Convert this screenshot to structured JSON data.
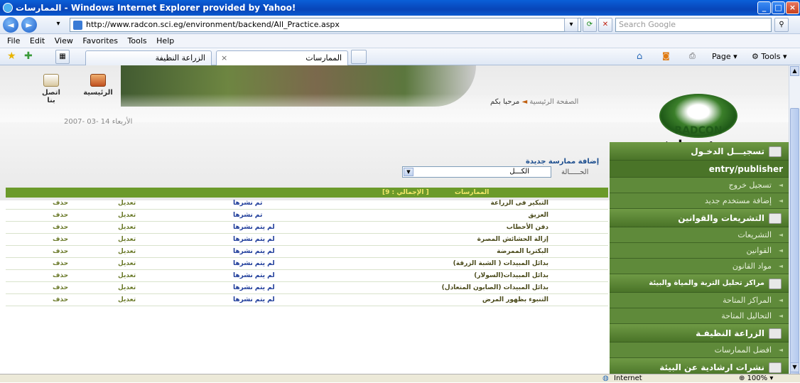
{
  "window": {
    "title": "الممارسات - Windows Internet Explorer provided by Yahoo!"
  },
  "address": {
    "url": "http://www.radcon.sci.eg/environment/backend/All_Practice.aspx",
    "search_placeholder": "Search Google"
  },
  "menu": {
    "file": "File",
    "edit": "Edit",
    "view": "View",
    "favorites": "Favorites",
    "tools": "Tools",
    "help": "Help"
  },
  "tabs": [
    {
      "label": "الزراعة النظيفة"
    },
    {
      "label": "الممارسات"
    }
  ],
  "toolbar": {
    "page": "Page",
    "tools": "Tools"
  },
  "top_icons": {
    "home": "الرئيسية",
    "contact": "اتصل بنا"
  },
  "breadcrumb": {
    "home": "الصفحة الرئيسية",
    "welcome": "مرحبا بكم"
  },
  "date": "الأربعاء 14 -03 -2007",
  "logo": {
    "name": "RADCON",
    "slogan": "نحو بيئة نظيفــة"
  },
  "form": {
    "add_link": "إضافة ممارسة جديدة",
    "filter_label": "الحـــــالة",
    "filter_value": "الكـــل"
  },
  "grid": {
    "header_title": "الممارسات",
    "header_total": "[الإجمالي : 9 ]"
  },
  "rows": [
    {
      "title": "التبكير فى الزراعة",
      "status": "تم نشرها",
      "edit": "تعديل",
      "delete": "حذف"
    },
    {
      "title": "العزيق",
      "status": "تم نشرها",
      "edit": "تعديل",
      "delete": "حذف"
    },
    {
      "title": "دفن الأحطاب",
      "status": "لم يتم نشرها",
      "edit": "تعديل",
      "delete": "حذف"
    },
    {
      "title": "إزالة الحشائش المصرة",
      "status": "لم يتم نشرها",
      "edit": "تعديل",
      "delete": "حذف"
    },
    {
      "title": "البكتريا الممرضة",
      "status": "لم يتم نشرها",
      "edit": "تعديل",
      "delete": "حذف"
    },
    {
      "title": "بدائل المبيدات ( الشبة الزرقة)",
      "status": "لم يتم نشرها",
      "edit": "تعديل",
      "delete": "حذف"
    },
    {
      "title": "بدائل المبيدات(السولار)",
      "status": "لم يتم نشرها",
      "edit": "تعديل",
      "delete": "حذف"
    },
    {
      "title": "بدائل المبيدات (الصابون المتعادل)",
      "status": "لم يتم نشرها",
      "edit": "تعديل",
      "delete": "حذف"
    },
    {
      "title": "التنبوء بظهور المرض",
      "status": "لم يتم نشرها",
      "edit": "تعديل",
      "delete": "حذف"
    }
  ],
  "sidebar": {
    "login_head": "تسجيـــل الدخـول",
    "user": "entry/publisher",
    "logout": "تسجيل خروج",
    "add_user": "إضافة مستخدم جديد",
    "laws_head": "التشريعات والقوانين",
    "legislation": "التشريعات",
    "laws": "القوانين",
    "law_articles": "مواد القانون",
    "labs_head": "مراكز تحليل التربة والمياة والبيئة",
    "centers": "المراكز المتاحة",
    "analyses": "التحاليل المتاحة",
    "clean_head": "الزراعة النظيفـة",
    "best_practices": "افضل الممارسات",
    "bulletins_head": "نشرات ارشادية عن البيئة"
  },
  "status": {
    "zone": "Internet",
    "zoom": "100%"
  }
}
